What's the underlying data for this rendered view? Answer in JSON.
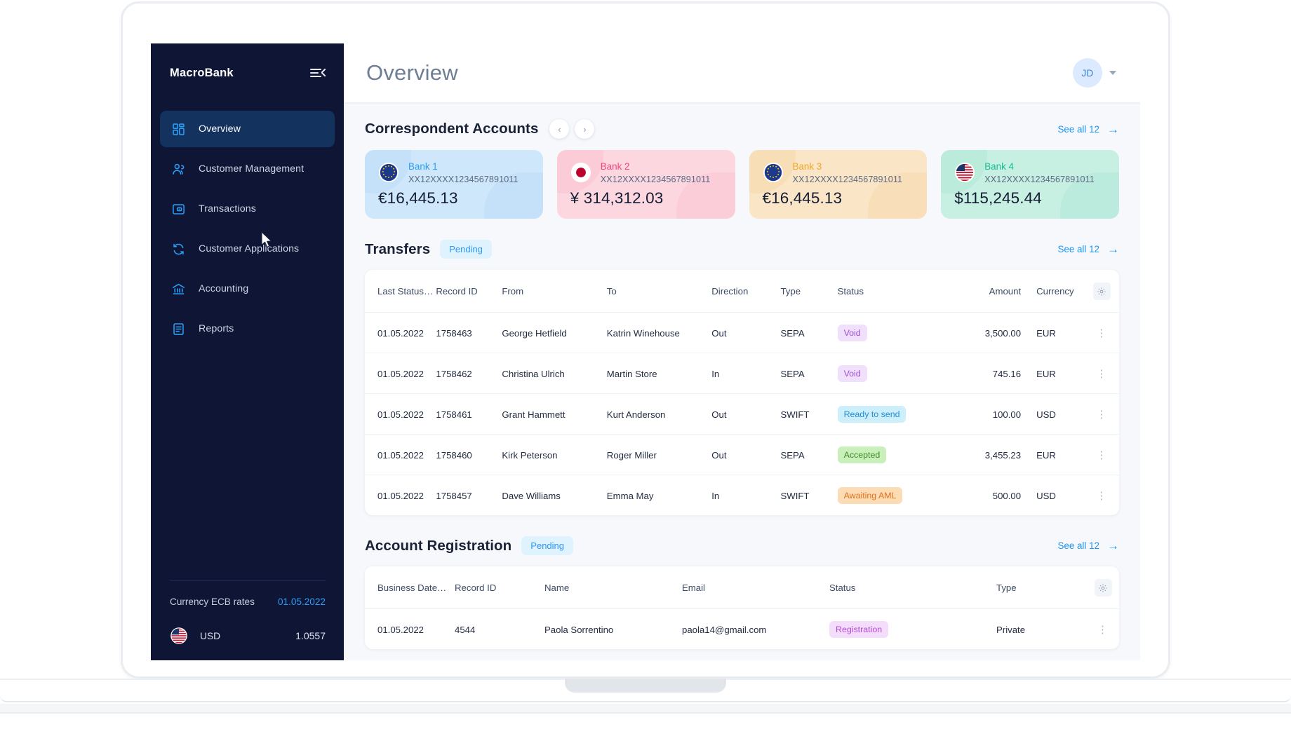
{
  "sidebar": {
    "brand": "MacroBank",
    "collapse_icon": "hamburger-collapse-icon",
    "items": [
      {
        "label": "Overview",
        "icon": "grid-dashboard-icon",
        "active": true
      },
      {
        "label": "Customer Management",
        "icon": "users-icon",
        "active": false
      },
      {
        "label": "Transactions",
        "icon": "wallet-card-icon",
        "active": false
      },
      {
        "label": "Customer Applications",
        "icon": "refresh-cycle-icon",
        "active": false
      },
      {
        "label": "Accounting",
        "icon": "bank-columns-icon",
        "active": false
      },
      {
        "label": "Reports",
        "icon": "document-lines-icon",
        "active": false
      }
    ],
    "rates": {
      "label": "Currency ECB rates",
      "date": "01.05.2022",
      "rows": [
        {
          "flag": "us-flag-icon",
          "code": "USD",
          "value": "1.0557"
        }
      ]
    }
  },
  "topbar": {
    "title": "Overview",
    "avatar_initials": "JD",
    "caret_icon": "chevron-down-icon"
  },
  "accounts_section": {
    "title": "Correspondent Accounts",
    "prev_label": "‹",
    "next_label": "›",
    "see_all": "See all 12",
    "cards": [
      {
        "flag": "eu-flag-icon",
        "name": "Bank 1",
        "iban": "XX12XXXX1234567891011",
        "amount": "€16,445.13",
        "bg": "#cfe7fb",
        "blob": "#bcdcf7",
        "name_color": "#2a9df5"
      },
      {
        "flag": "jp-flag-icon",
        "name": "Bank 2",
        "iban": "XX12XXXX1234567891011",
        "amount": "¥ 314,312.03",
        "bg": "#fcd7e0",
        "blob": "#f9c3d1",
        "name_color": "#f4457e"
      },
      {
        "flag": "eu-flag-icon",
        "name": "Bank 3",
        "iban": "XX12XXXX1234567891011",
        "amount": "€16,445.13",
        "bg": "#fae6c6",
        "blob": "#f6d7ab",
        "name_color": "#f0a52a"
      },
      {
        "flag": "us-flag-icon",
        "name": "Bank 4",
        "iban": "XX12XXXX1234567891011",
        "amount": "$115,245.44",
        "bg": "#c7efe2",
        "blob": "#b0e7d6",
        "name_color": "#17bd93"
      }
    ]
  },
  "transfers_section": {
    "title": "Transfers",
    "pill": "Pending",
    "see_all": "See all 12",
    "gear_icon": "gear-icon",
    "columns": [
      "Last Status…",
      "Record ID",
      "From",
      "To",
      "Direction",
      "Type",
      "Status",
      "Amount",
      "Currency"
    ],
    "rows": [
      {
        "last_status": "01.05.2022",
        "record_id": "1758463",
        "from": "George Hetfield",
        "to": "Katrin Winehouse",
        "direction": "Out",
        "type": "SEPA",
        "status": "Void",
        "status_bg": "#f0e0fb",
        "status_color": "#9b4fd6",
        "amount": "3,500.00",
        "currency": "EUR"
      },
      {
        "last_status": "01.05.2022",
        "record_id": "1758462",
        "from": "Christina Ulrich",
        "to": "Martin Store",
        "direction": "In",
        "type": "SEPA",
        "status": "Void",
        "status_bg": "#f0e0fb",
        "status_color": "#9b4fd6",
        "amount": "745.16",
        "currency": "EUR"
      },
      {
        "last_status": "01.05.2022",
        "record_id": "1758461",
        "from": "Grant Hammett",
        "to": "Kurt Anderson",
        "direction": "Out",
        "type": "SWIFT",
        "status": "Ready to send",
        "status_bg": "#cdeefb",
        "status_color": "#1f8ed4",
        "amount": "100.00",
        "currency": "USD"
      },
      {
        "last_status": "01.05.2022",
        "record_id": "1758460",
        "from": "Kirk Peterson",
        "to": "Roger Miller",
        "direction": "Out",
        "type": "SEPA",
        "status": "Accepted",
        "status_bg": "#c9f0ba",
        "status_color": "#3f8a2a",
        "amount": "3,455.23",
        "currency": "EUR"
      },
      {
        "last_status": "01.05.2022",
        "record_id": "1758457",
        "from": "Dave Williams",
        "to": "Emma  May",
        "direction": "In",
        "type": "SWIFT",
        "status": "Awaiting AML",
        "status_bg": "#fcdcb4",
        "status_color": "#e2701a",
        "amount": "500.00",
        "currency": "USD"
      }
    ],
    "kebab_icon": "more-vertical-icon"
  },
  "registration_section": {
    "title": "Account Registration",
    "pill": "Pending",
    "see_all": "See all 12",
    "gear_icon": "gear-icon",
    "columns": [
      "Business Date…",
      "Record ID",
      "Name",
      "Email",
      "Status",
      "Type"
    ],
    "rows": [
      {
        "business_date": "01.05.2022",
        "record_id": "4544",
        "name": "Paola Sorrentino",
        "email": "paola14@gmail.com",
        "status": "Registration",
        "status_bg": "#f3ddfb",
        "status_color": "#b349d6",
        "type": "Private"
      }
    ],
    "kebab_icon": "more-vertical-icon"
  },
  "theme": {
    "sidebar_bg": "#0e1535",
    "sidebar_active_bg": "#14325e",
    "accent": "#1d95f3",
    "app_bg": "#f6f8fb"
  }
}
